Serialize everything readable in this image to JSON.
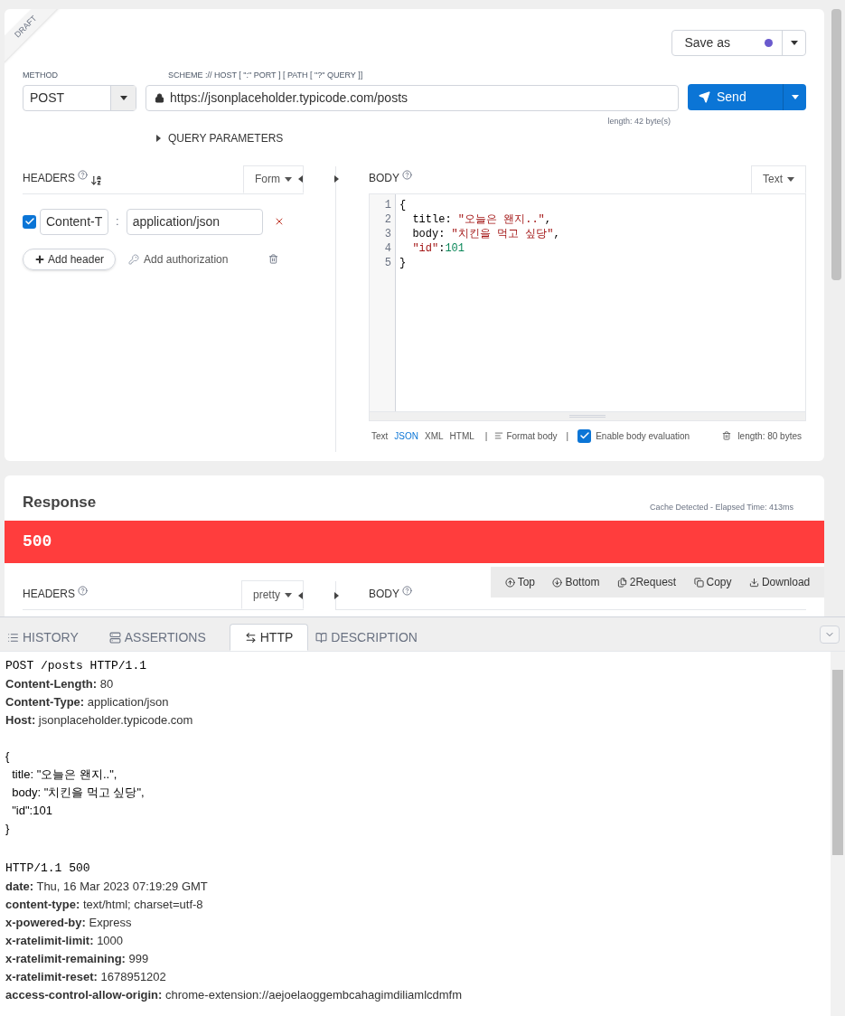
{
  "request": {
    "ribbon": "DRAFT",
    "save_button": "Save as",
    "save_dot": {
      "color": "#6a5acd"
    },
    "method_label": "METHOD",
    "method": "POST",
    "url_label": "SCHEME :// HOST [ \":\" PORT ] [ PATH [ \"?\" QUERY ]]",
    "url": "https://jsonplaceholder.typicode.com/posts",
    "url_length": "length: 42 byte(s)",
    "send_button": "Send",
    "query_toggle": "QUERY PARAMETERS",
    "expanded": false,
    "headers": {
      "title": "HEADERS",
      "mode": "Form",
      "items": [
        {
          "checked": true,
          "name": "Content-T",
          "separator": ":",
          "value": "application/json"
        }
      ],
      "add_header": "Add header",
      "add_auth": "Add authorization"
    },
    "body": {
      "title": "BODY",
      "mode": "Text",
      "lines": [
        [
          {
            "kind": "punct",
            "text": "{"
          }
        ],
        [
          {
            "kind": "punct",
            "text": "  title: "
          },
          {
            "kind": "string",
            "text": "\"오늘은 왠지..\""
          },
          {
            "kind": "punct",
            "text": ","
          }
        ],
        [
          {
            "kind": "punct",
            "text": "  body: "
          },
          {
            "kind": "string",
            "text": "\"치킨을 먹고 싶당\""
          },
          {
            "kind": "punct",
            "text": ","
          }
        ],
        [
          {
            "kind": "string",
            "text": "  \"id\""
          },
          {
            "kind": "punct",
            "text": ":"
          },
          {
            "kind": "number",
            "text": "101"
          }
        ],
        [
          {
            "kind": "punct",
            "text": "}"
          }
        ]
      ],
      "line_numbers": [
        "1",
        "2",
        "3",
        "4",
        "5"
      ],
      "formats": [
        {
          "label": "Text",
          "selected": false
        },
        {
          "label": "JSON",
          "selected": true
        },
        {
          "label": "XML",
          "selected": false
        },
        {
          "label": "HTML",
          "selected": false
        }
      ],
      "sep": "|",
      "format_body": "Format body",
      "evaluation": {
        "label": "Enable body evaluation",
        "checked": true
      },
      "length": "length: 80 bytes"
    }
  },
  "response": {
    "title": "Response",
    "meta": "Cache Detected - Elapsed Time: 413ms",
    "status": {
      "code": "500",
      "color": "#ff3d3d"
    },
    "headers_title": "HEADERS",
    "mode": "pretty",
    "body_title": "BODY",
    "toolbar": [
      {
        "kind": "top",
        "label": "Top"
      },
      {
        "kind": "bottom",
        "label": "Bottom"
      },
      {
        "kind": "request",
        "label": "2Request"
      },
      {
        "kind": "copy",
        "label": "Copy"
      },
      {
        "kind": "download",
        "label": "Download"
      }
    ]
  },
  "tabs": [
    {
      "kind": "history",
      "label": "HISTORY",
      "selected": false
    },
    {
      "kind": "assertions",
      "label": "ASSERTIONS",
      "selected": false
    },
    {
      "kind": "http",
      "label": "HTTP",
      "selected": true
    },
    {
      "kind": "description",
      "label": "DESCRIPTION",
      "selected": false
    }
  ],
  "http": {
    "request_line": "POST /posts HTTP/1.1",
    "request_headers": [
      {
        "name": "Content-Length:",
        "value": "80"
      },
      {
        "name": "Content-Type:",
        "value": "application/json"
      },
      {
        "name": "Host:",
        "value": "jsonplaceholder.typicode.com"
      }
    ],
    "request_body": [
      "{",
      "  title: \"오늘은 왠지..\",",
      "  body: \"치킨을 먹고 싶당\",",
      "  \"id\":101",
      "}"
    ],
    "status_line": "HTTP/1.1 500",
    "response_headers": [
      {
        "name": "date:",
        "value": "Thu, 16 Mar 2023 07:19:29 GMT"
      },
      {
        "name": "content-type:",
        "value": "text/html; charset=utf-8"
      },
      {
        "name": "x-powered-by:",
        "value": "Express"
      },
      {
        "name": "x-ratelimit-limit:",
        "value": "1000"
      },
      {
        "name": "x-ratelimit-remaining:",
        "value": "999"
      },
      {
        "name": "x-ratelimit-reset:",
        "value": "1678951202"
      },
      {
        "name": "access-control-allow-origin:",
        "value": "chrome-extension://aejoelaoggembcahagimdiliamlcdmfm"
      }
    ]
  }
}
